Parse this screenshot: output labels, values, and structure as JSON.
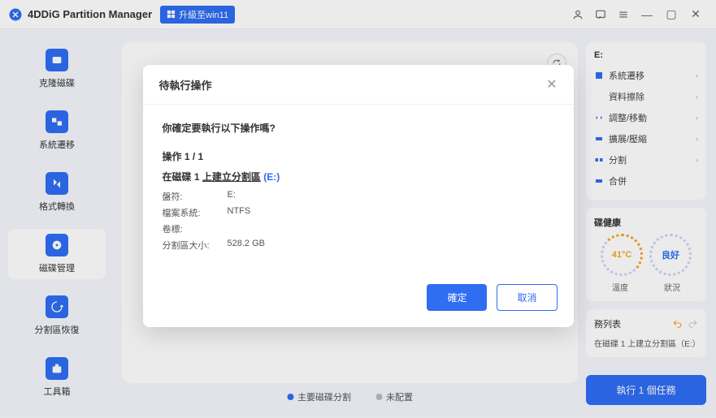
{
  "titlebar": {
    "appname": "4DDiG Partition Manager",
    "upgrade": "升級至win11"
  },
  "sidebar": {
    "items": [
      {
        "label": "克隆磁碟"
      },
      {
        "label": "系統遷移"
      },
      {
        "label": "格式轉換"
      },
      {
        "label": "磁碟管理"
      },
      {
        "label": "分割區恢復"
      },
      {
        "label": "工具箱"
      }
    ]
  },
  "legend": {
    "primary": "主要磁碟分割",
    "unallocated": "未配置"
  },
  "rightpanel": {
    "drive": "E:",
    "actions": [
      "系統遷移",
      "資料擦除",
      "調整/移動",
      "擴展/壓縮",
      "分割",
      "合併"
    ],
    "health_title": "碟健康",
    "temp_value": "41°C",
    "status_value": "良好",
    "temp_label": "溫度",
    "status_label": "狀況",
    "queue_title": "務列表",
    "queue_item": "在磁碟 1 上建立分割區（E:）",
    "exec_btn": "執行 1 個任務"
  },
  "modal": {
    "title": "待執行操作",
    "question": "你確定要執行以下操作嗎?",
    "op_count": "操作 1 / 1",
    "op_title_prefix": "在磁碟 1 ",
    "op_title_action": "上建立分割區",
    "op_drive": "(E:)",
    "rows": {
      "drive_k": "盤符:",
      "drive_v": "E:",
      "fs_k": "檔案系統:",
      "fs_v": "NTFS",
      "label_k": "卷標:",
      "label_v": "",
      "size_k": "分割區大小:",
      "size_v": "528.2 GB"
    },
    "ok": "確定",
    "cancel": "取消"
  }
}
